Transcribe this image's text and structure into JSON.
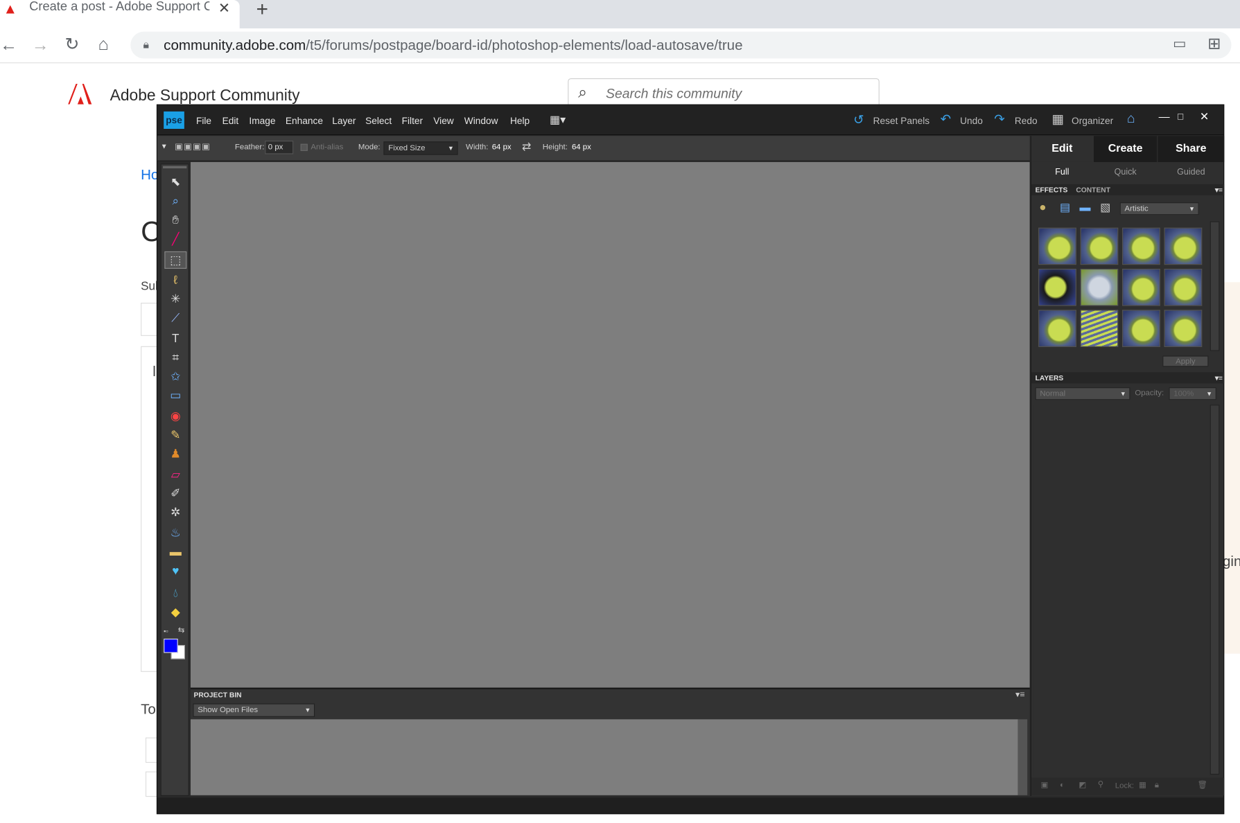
{
  "browser": {
    "tab_title": "Create a post - Adobe Support C",
    "url_host": "community.adobe.com",
    "url_path": "/t5/forums/postpage/board-id/photoshop-elements/load-autosave/true"
  },
  "community": {
    "title": "Adobe Support Community",
    "search_placeholder": "Search this community",
    "bg_fragments": {
      "home": "Ho",
      "heading": "C",
      "subject": "Sul",
      "bar": "l",
      "tags": "To",
      "right": "gin"
    }
  },
  "pse": {
    "logo": "pse",
    "menu": [
      "File",
      "Edit",
      "Image",
      "Enhance",
      "Layer",
      "Select",
      "Filter",
      "View",
      "Window",
      "Help"
    ],
    "toolbar_actions": {
      "reset_panels": "Reset Panels",
      "undo": "Undo",
      "redo": "Redo",
      "organizer": "Organizer"
    },
    "options": {
      "feather_label": "Feather:",
      "feather_value": "0 px",
      "antialias": "Anti-alias",
      "mode_label": "Mode:",
      "mode_value": "Fixed Size",
      "width_label": "Width:",
      "width_value": "64 px",
      "height_label": "Height:",
      "height_value": "64 px"
    },
    "mode_tabs": [
      "Edit",
      "Create",
      "Share"
    ],
    "sub_tabs": [
      "Full",
      "Quick",
      "Guided"
    ],
    "effects": {
      "tab1": "EFFECTS",
      "tab2": "CONTENT",
      "category": "Artistic",
      "apply": "Apply"
    },
    "layers": {
      "title": "LAYERS",
      "blend": "Normal",
      "opacity_label": "Opacity:",
      "opacity_value": "100%",
      "lock_label": "Lock:"
    },
    "project_bin": {
      "title": "PROJECT BIN",
      "dropdown": "Show Open Files"
    },
    "colors": {
      "foreground": "#0000ff",
      "background": "#ffffff",
      "accent": "#1aa0e6"
    }
  }
}
